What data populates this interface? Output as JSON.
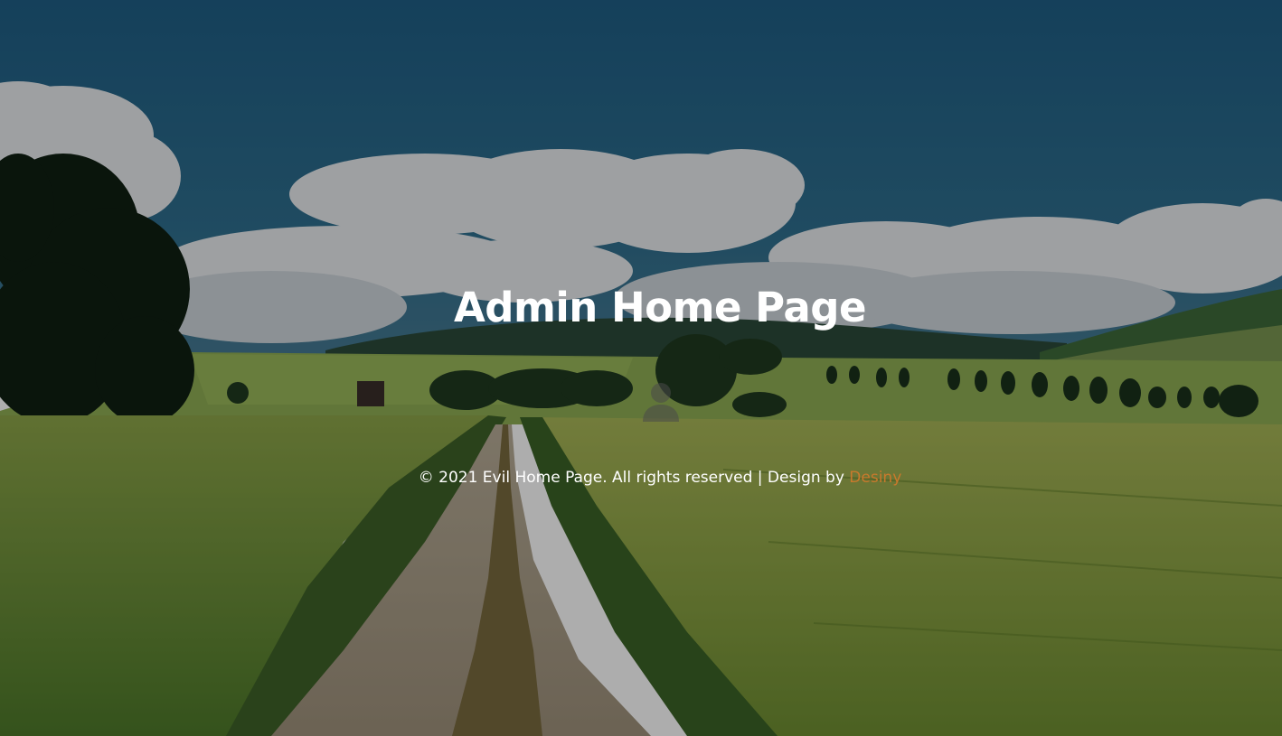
{
  "page": {
    "title": "Admin Home Page",
    "background": "countryside-field-road-photo"
  },
  "avatar": {
    "icon": "user-icon"
  },
  "footer": {
    "copyright": "© 2021 Evil Home Page. All rights reserved | Design by ",
    "designer_link": "Desiny",
    "link_color": "#c9792c"
  }
}
